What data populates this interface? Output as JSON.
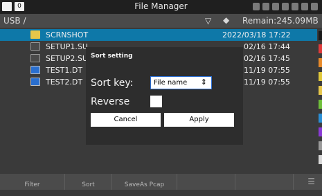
{
  "titlebar": {
    "title": "File Manager",
    "box_label": "0"
  },
  "pathbar": {
    "path": "USB /",
    "remain": "Remain:245.09MB"
  },
  "files": [
    {
      "name": "SCRNSHOT",
      "date": "2022/03/18 17:22",
      "type": "folder",
      "selected": true
    },
    {
      "name": "SETUP1.SU",
      "date": "02/16 17:44",
      "type": "setup"
    },
    {
      "name": "SETUP2.SU",
      "date": "02/16 17:45",
      "type": "setup"
    },
    {
      "name": "TEST1.DT",
      "date": "11/19 07:55",
      "type": "dt"
    },
    {
      "name": "TEST2.DT",
      "date": "11/19 07:55",
      "type": "dt"
    }
  ],
  "softkeys": {
    "k1": "Filter",
    "k2": "Sort",
    "k3": "SaveAs Pcap"
  },
  "dialog": {
    "title": "Sort setting",
    "sort_key_label": "Sort key:",
    "sort_key_value": "File name",
    "reverse_label": "Reverse",
    "cancel": "Cancel",
    "apply": "Apply"
  },
  "colors": {
    "selection": "#0e78a8",
    "accent": "#2b6fd6"
  }
}
